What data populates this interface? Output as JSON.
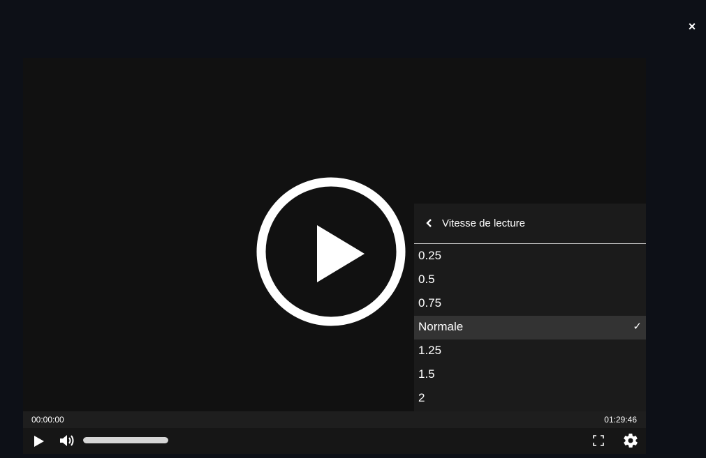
{
  "modal": {
    "close_label": "×"
  },
  "player": {
    "current_time": "00:00:00",
    "duration": "01:29:46",
    "volume_level": 1.0
  },
  "speed_menu": {
    "title": "Vitesse de lecture",
    "items": [
      {
        "label": "0.25",
        "selected": false
      },
      {
        "label": "0.5",
        "selected": false
      },
      {
        "label": "0.75",
        "selected": false
      },
      {
        "label": "Normale",
        "selected": true
      },
      {
        "label": "1.25",
        "selected": false
      },
      {
        "label": "1.5",
        "selected": false
      },
      {
        "label": "2",
        "selected": false
      }
    ],
    "check_mark": "✓"
  },
  "icons": {
    "close": "close-icon",
    "big_play": "play-circle-icon",
    "back": "chevron-left-icon",
    "play": "play-icon",
    "volume": "volume-icon",
    "fullscreen": "fullscreen-icon",
    "settings": "gear-icon"
  },
  "colors": {
    "background": "#0d1017",
    "player_bg": "#111111",
    "menu_bg": "#1b1b1b",
    "selected_bg": "#333333",
    "icon": "#ffffff"
  }
}
